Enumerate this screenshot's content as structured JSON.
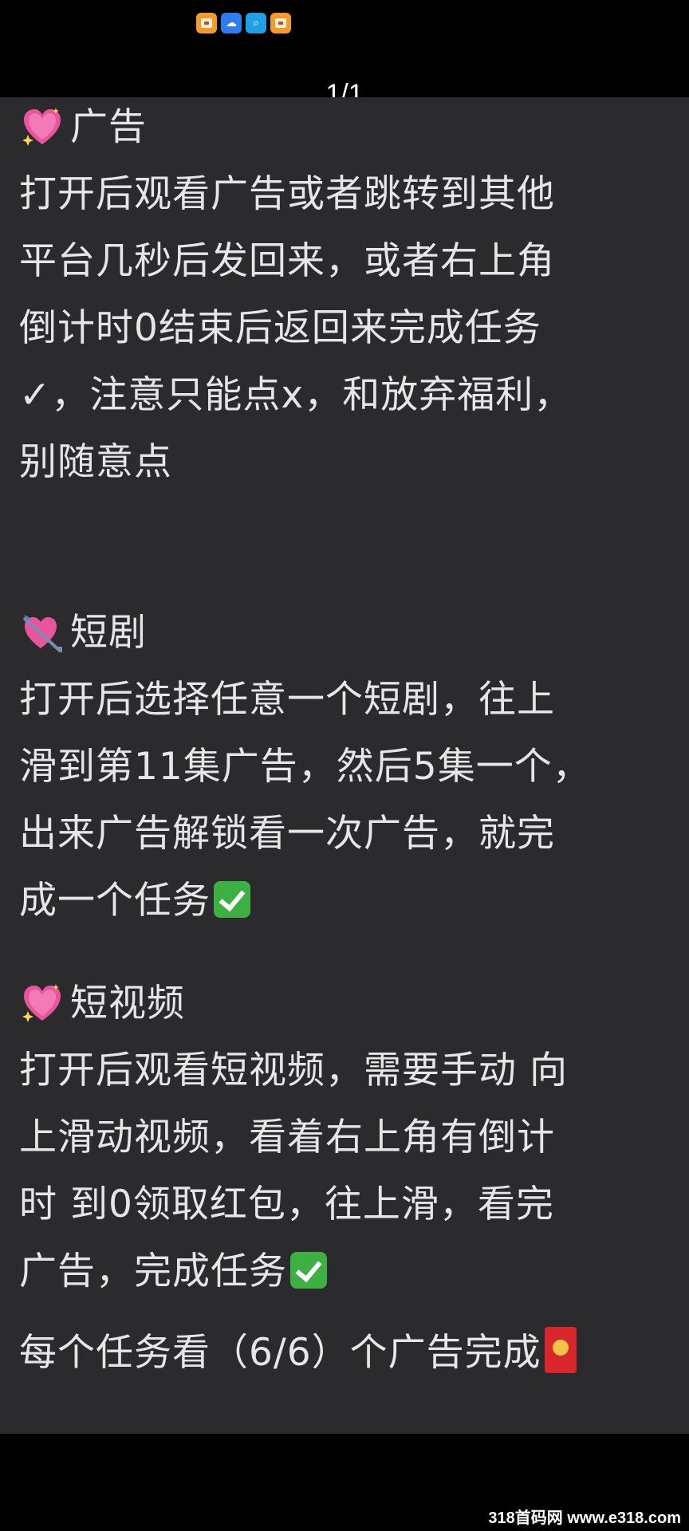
{
  "status_bar": {
    "icons": [
      "gift-app-icon",
      "weather-app-icon",
      "search-app-icon",
      "gift-app-icon"
    ]
  },
  "page_indicator": "1/1",
  "sections": [
    {
      "emoji": "sparkling-heart-icon",
      "title": "广告",
      "lines": [
        "打开后观看广告或者跳转到其他",
        "平台几秒后发回来，或者右上角",
        "倒计时0结束后返回来完成任务",
        "✓，注意只能点x，和放弃福利，",
        "别随意点"
      ]
    },
    {
      "emoji": "heart-with-arrow-icon",
      "title": "短剧",
      "lines": [
        "打开后选择任意一个短剧，往上",
        "滑到第11集广告，然后5集一个，",
        "出来广告解锁看一次广告，就完",
        "成一个任务"
      ]
    },
    {
      "emoji": "sparkling-heart-icon",
      "title": "短视频",
      "lines": [
        "打开后观看短视频，需要手动 向",
        "上滑动视频，看着右上角有倒计",
        "时 到0领取红包，往上滑，看完",
        "广告，完成任务"
      ]
    }
  ],
  "summary": "每个任务看（6/6）个广告完成",
  "watermark": "318首码网 www.e318.com",
  "colors": {
    "background": "#2b2b2d",
    "text": "#e6e6e6",
    "check": "#3cb043",
    "envelope": "#d8262b"
  }
}
